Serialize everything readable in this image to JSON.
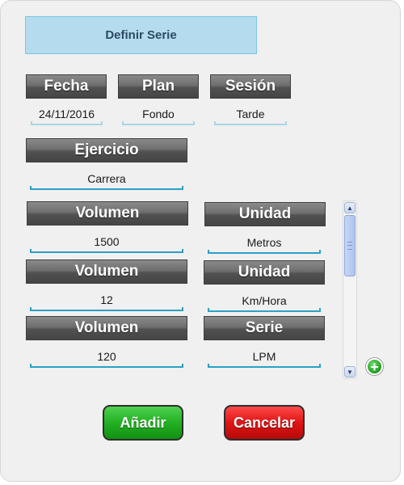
{
  "dialog": {
    "title": "Definir Serie"
  },
  "top_row": {
    "fecha": {
      "label": "Fecha",
      "value": "24/11/2016"
    },
    "plan": {
      "label": "Plan",
      "value": "Fondo"
    },
    "sesion": {
      "label": "Sesión",
      "value": "Tarde"
    }
  },
  "ejercicio": {
    "label": "Ejercicio",
    "value": "Carrera"
  },
  "rows": [
    {
      "left_label": "Volumen",
      "left_value": "1500",
      "right_label": "Unidad",
      "right_value": "Metros"
    },
    {
      "left_label": "Volumen",
      "left_value": "12",
      "right_label": "Unidad",
      "right_value": "Km/Hora"
    },
    {
      "left_label": "Volumen",
      "left_value": "120",
      "right_label": "Serie",
      "right_value": "LPM"
    }
  ],
  "icons": {
    "scroll_up": "scroll-up-icon",
    "scroll_down": "scroll-down-icon",
    "add_row": "plus-circle-icon"
  },
  "actions": {
    "add_label": "Añadir",
    "cancel_label": "Cancelar"
  },
  "colors": {
    "title_bg": "#b4dcee",
    "field_underline": "#2da0c4",
    "add_button": "#23b023",
    "cancel_button": "#e01414"
  }
}
